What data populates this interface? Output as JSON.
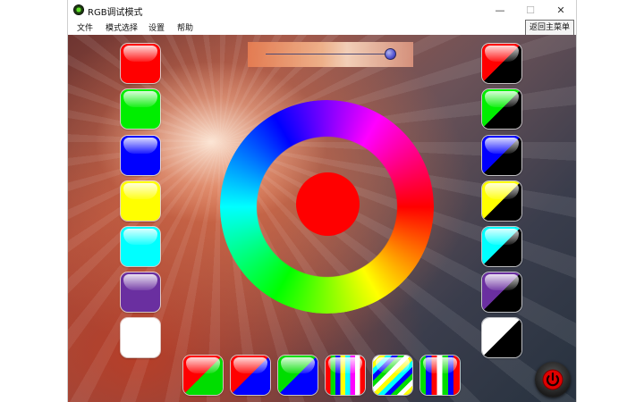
{
  "window": {
    "title": "RGB调试模式",
    "minimize": "—",
    "maximize": "☐",
    "close": "✕"
  },
  "menu": [
    {
      "label": "文件"
    },
    {
      "label": "模式选择"
    },
    {
      "label": "设置"
    },
    {
      "label": "帮助"
    }
  ],
  "back_button": "返回主菜单",
  "slider": {
    "value": 0.96
  },
  "wheel": {
    "selected_color": "#ff0000"
  },
  "left_colors": [
    "#ff0000",
    "#00ee00",
    "#0000ff",
    "#ffff00",
    "#00ffff",
    "#6a2fa0",
    "#ffffff"
  ],
  "right_colors": [
    "#ff0000",
    "#00ee00",
    "#0000ff",
    "#ffff00",
    "#00ffff",
    "#6a2fa0",
    "#ffffff"
  ],
  "bottom_patterns": [
    {
      "name": "red-green"
    },
    {
      "name": "red-blue"
    },
    {
      "name": "green-blue"
    },
    {
      "name": "vertical-stripes"
    },
    {
      "name": "diagonal-stripes"
    },
    {
      "name": "vertical-stripes-2"
    }
  ],
  "icons": {
    "app": "rgb-app-icon",
    "power": "power-icon"
  }
}
